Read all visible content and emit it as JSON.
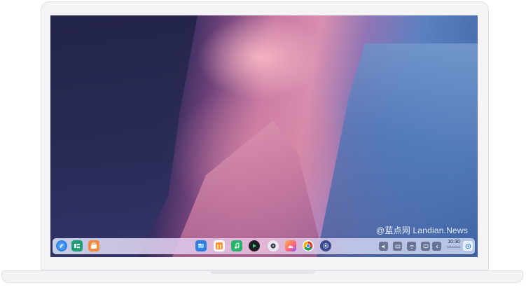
{
  "watermark": "@蓝点网 Landian.News",
  "dock": {
    "left_icons": [
      "launcher-icon",
      "multitask-view-icon",
      "app-store-icon"
    ],
    "center_icons": [
      "file-manager-icon",
      "calendar-icon",
      "music-icon",
      "video-player-icon",
      "camera-icon",
      "image-viewer-icon",
      "chrome-icon",
      "settings-icon"
    ],
    "tray_icons": [
      "volume-icon",
      "keyboard-icon",
      "wifi-icon",
      "display-icon",
      "chevron-left-icon"
    ],
    "clock": {
      "time": "10:30",
      "date": "2023/03/01"
    },
    "notification_icon": "notification-center-icon"
  }
}
